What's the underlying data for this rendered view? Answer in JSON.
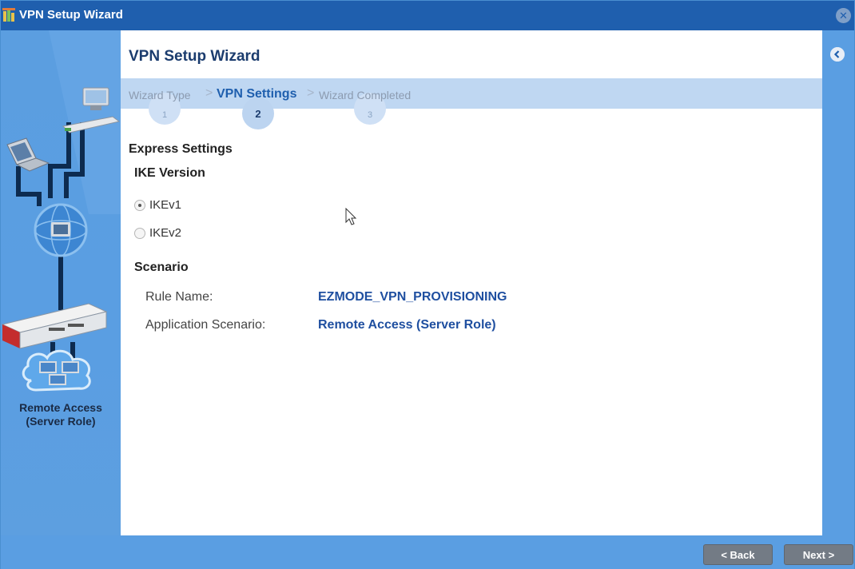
{
  "window": {
    "title": "VPN Setup Wizard"
  },
  "page": {
    "title": "VPN Setup Wizard"
  },
  "steps": [
    {
      "number": "1",
      "label": "Wizard Type",
      "state": "done"
    },
    {
      "number": "2",
      "label": "VPN Settings",
      "state": "active"
    },
    {
      "number": "3",
      "label": "Wizard Completed",
      "state": "pending"
    }
  ],
  "express": {
    "heading": "Express Settings",
    "ike_heading": "IKE Version",
    "ike_options": [
      {
        "label": "IKEv1",
        "checked": true
      },
      {
        "label": "IKEv2",
        "checked": false
      }
    ],
    "scenario_heading": "Scenario",
    "rule_name_label": "Rule Name:",
    "rule_name_value": "EZMODE_VPN_PROVISIONING",
    "app_scenario_label": "Application Scenario:",
    "app_scenario_value": "Remote Access (Server Role)"
  },
  "left_panel": {
    "caption_line1": "Remote Access",
    "caption_line2": "(Server Role)"
  },
  "footer": {
    "back_label": "< Back",
    "next_label": "Next >"
  },
  "icons": {
    "title": "wizard-icon",
    "close": "close-icon",
    "collapse": "chevron-left-icon",
    "cursor": "mouse-pointer-icon"
  },
  "colors": {
    "titlebar": "#1f5fae",
    "panel": "#5a9ee2",
    "progress_band": "#bfd7f2",
    "value_text": "#1f4fa0",
    "button": "#737b85"
  }
}
